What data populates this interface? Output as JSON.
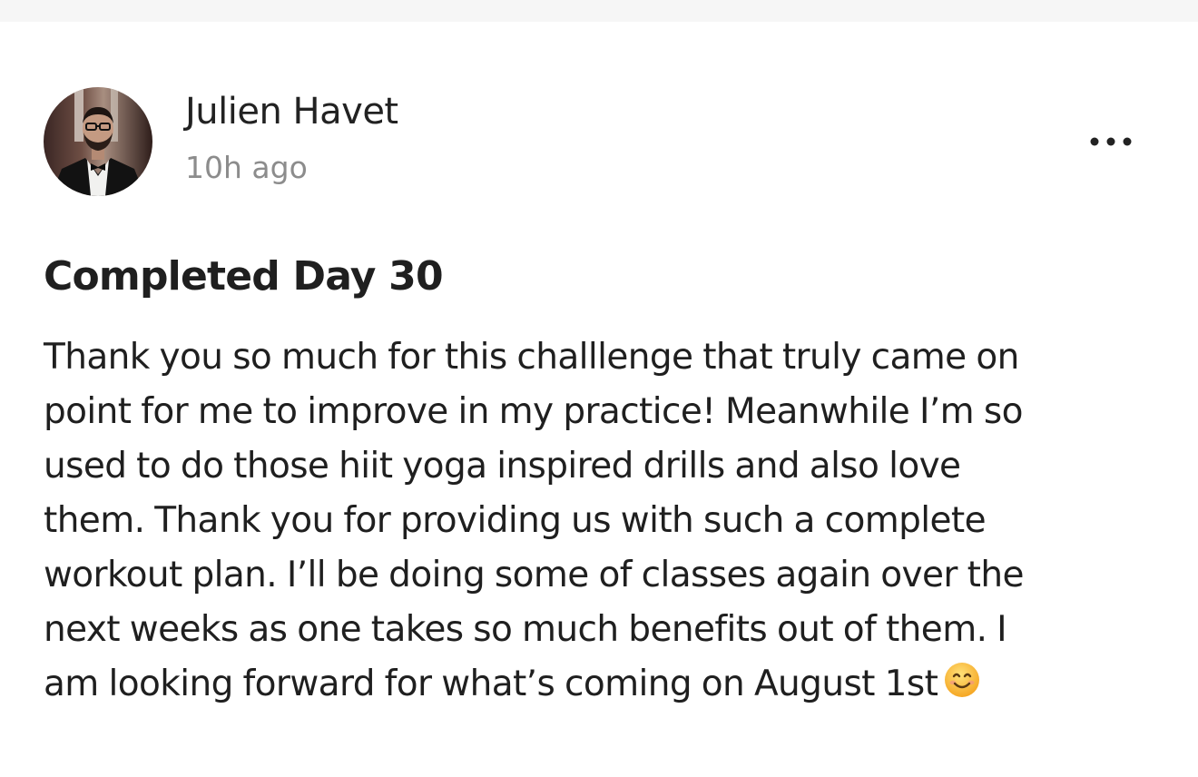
{
  "post": {
    "author": {
      "name": "Julien Havet",
      "avatar_icon": "person-photo"
    },
    "timestamp": "10h ago",
    "more_icon": "more-horizontal-icon",
    "title": "Completed Day 30",
    "body_lines": [
      "Thank you so much for this challlenge that truly came on",
      "point for me to improve in my practice! Meanwhile I’m so",
      "used to do those hiit yoga inspired drills and also love",
      "them. Thank you for providing us with such a complete",
      "workout plan. I’ll be doing some of classes again over the",
      "next weeks as one takes so much benefits out of them. I",
      "am looking forward for what’s coming on August 1st"
    ],
    "trailing_emoji_icon": "smiling-face-emoji"
  },
  "colors": {
    "strip_bg": "#f6f6f6",
    "text_primary": "#1f1f1f",
    "text_secondary": "#8c8c8c",
    "emoji_yellow": "#ffc83d"
  }
}
